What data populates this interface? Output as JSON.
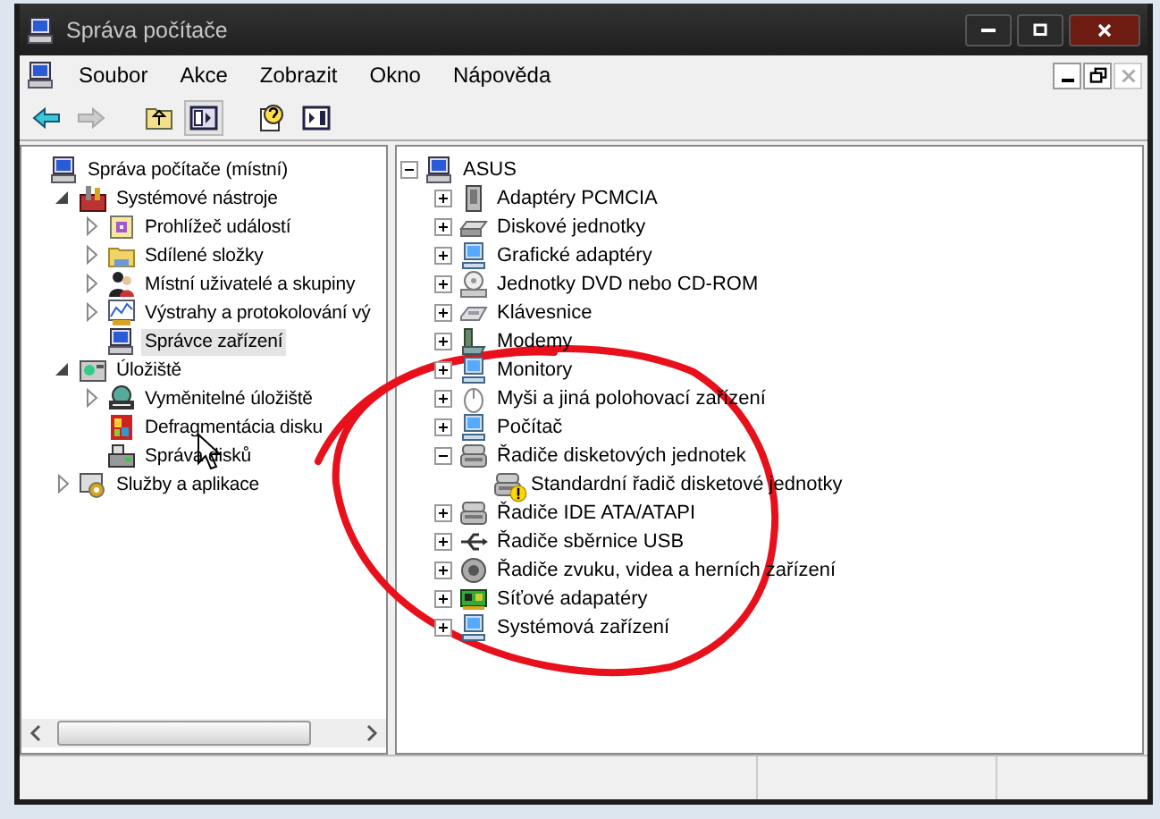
{
  "window": {
    "title": "Správa počítače"
  },
  "menu": [
    "Soubor",
    "Akce",
    "Zobrazit",
    "Okno",
    "Nápověda"
  ],
  "mdi_buttons": [
    {
      "kind": "minimize",
      "disabled": false
    },
    {
      "kind": "restore",
      "disabled": false
    },
    {
      "kind": "close",
      "disabled": true
    }
  ],
  "toolbar": [
    {
      "kind": "back",
      "disabled": false,
      "pressed": false
    },
    {
      "kind": "forward",
      "disabled": true,
      "pressed": false
    },
    {
      "kind": "up",
      "disabled": false,
      "pressed": false
    },
    {
      "kind": "console-tree",
      "disabled": false,
      "pressed": true
    },
    {
      "kind": "help",
      "disabled": false,
      "pressed": false
    },
    {
      "kind": "action-pane",
      "disabled": false,
      "pressed": false
    }
  ],
  "console_tree": [
    {
      "label": "Správa počítače (místní)",
      "kind": "computer",
      "selected": false,
      "children": [
        {
          "label": "Systémové nástroje",
          "kind": "tools",
          "selected": false,
          "expanded": true,
          "children": [
            {
              "label": "Prohlížeč událostí",
              "kind": "log",
              "selected": false,
              "expanded": false
            },
            {
              "label": "Sdílené složky",
              "kind": "folder",
              "selected": false,
              "expanded": false
            },
            {
              "label": "Místní uživatelé a skupiny",
              "kind": "users",
              "selected": false,
              "expanded": false
            },
            {
              "label": "Výstrahy a protokolování vý",
              "kind": "chart",
              "selected": false,
              "expanded": false
            },
            {
              "label": "Správce zařízení",
              "kind": "computer",
              "selected": true
            }
          ]
        },
        {
          "label": "Úložiště",
          "kind": "storage",
          "selected": false,
          "expanded": true,
          "children": [
            {
              "label": "Vyměnitelné úložiště",
              "kind": "removable",
              "selected": false,
              "expanded": false
            },
            {
              "label": "Defragmentácia disku",
              "kind": "defrag",
              "selected": false
            },
            {
              "label": "Správa disků",
              "kind": "disk",
              "selected": false
            }
          ]
        },
        {
          "label": "Služby a aplikace",
          "kind": "services",
          "selected": false,
          "expanded": false
        }
      ]
    }
  ],
  "device_tree": [
    {
      "label": "ASUS",
      "kind": "computer",
      "expanded": true,
      "children": [
        {
          "label": "Adaptéry PCMCIA",
          "kind": "card",
          "expanded": false
        },
        {
          "label": "Diskové jednotky",
          "kind": "drive",
          "expanded": false
        },
        {
          "label": "Grafické adaptéry",
          "kind": "display",
          "expanded": false
        },
        {
          "label": "Jednotky DVD nebo CD-ROM",
          "kind": "disc",
          "expanded": false
        },
        {
          "label": "Klávesnice",
          "kind": "keyboard",
          "expanded": false
        },
        {
          "label": "Modemy",
          "kind": "phone",
          "expanded": false
        },
        {
          "label": "Monitory",
          "kind": "display",
          "expanded": false
        },
        {
          "label": "Myši a jiná polohovací zařízení",
          "kind": "mouse",
          "expanded": false
        },
        {
          "label": "Počítač",
          "kind": "display",
          "expanded": false
        },
        {
          "label": "Řadiče disketových jednotek",
          "kind": "controller",
          "expanded": true,
          "children": [
            {
              "label": "Standardní řadič disketové jednotky",
              "kind": "controller",
              "warning": true
            }
          ]
        },
        {
          "label": "Řadiče IDE ATA/ATAPI",
          "kind": "controller",
          "expanded": false
        },
        {
          "label": "Řadiče sběrnice USB",
          "kind": "usb",
          "expanded": false
        },
        {
          "label": "Řadiče zvuku, videa a herních zařízení",
          "kind": "speaker",
          "expanded": false
        },
        {
          "label": "Síťové adapatéry",
          "kind": "netcard",
          "expanded": false
        },
        {
          "label": "Systémová zařízení",
          "kind": "display",
          "expanded": false
        }
      ]
    }
  ]
}
